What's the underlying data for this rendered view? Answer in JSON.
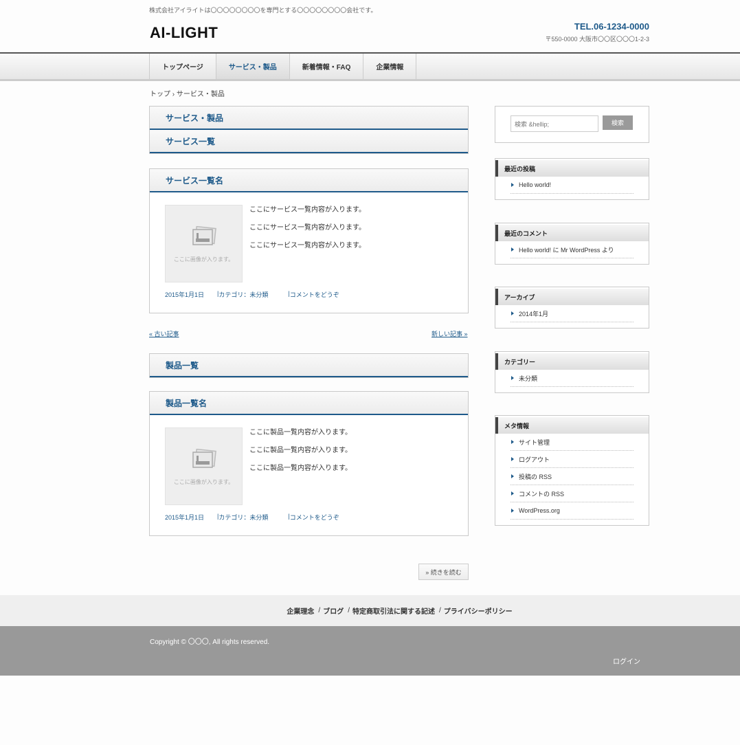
{
  "header": {
    "tagline": "株式会社アイライトは〇〇〇〇〇〇〇〇を専門とする〇〇〇〇〇〇〇〇会社です。",
    "logo": "AI-LIGHT",
    "tel": "TEL.06-1234-0000",
    "address": "〒550-0000 大阪市〇〇区〇〇〇1-2-3"
  },
  "nav": [
    {
      "label": "トップページ"
    },
    {
      "label": "サービス・製品"
    },
    {
      "label": "新着情報・FAQ"
    },
    {
      "label": "企業情報"
    }
  ],
  "breadcrumb": "トップ › サービス・製品",
  "main": {
    "page_title": "サービス・製品",
    "section1_title": "サービス一覧",
    "post1": {
      "title": "サービス一覧名",
      "thumb_text": "ここに画像が入ります。",
      "lines": [
        "ここにサービス一覧内容が入ります。",
        "ここにサービス一覧内容が入ります。",
        "ここにサービス一覧内容が入ります。"
      ],
      "date": "2015年1月1日",
      "category": "カテゴリ：未分類",
      "comment": "コメントをどうぞ"
    },
    "pager_prev": "« 古い記事",
    "pager_next": "新しい記事 »",
    "section2_title": "製品一覧",
    "post2": {
      "title": "製品一覧名",
      "thumb_text": "ここに画像が入ります。",
      "lines": [
        "ここに製品一覧内容が入ります。",
        "ここに製品一覧内容が入ります。",
        "ここに製品一覧内容が入ります。"
      ],
      "date": "2015年1月1日",
      "category": "カテゴリ：未分類",
      "comment": "コメントをどうぞ"
    },
    "more": "» 続きを読む"
  },
  "sidebar": {
    "search_placeholder": "検索 &hellip;",
    "search_button": "検索",
    "recent_posts": {
      "title": "最近の投稿",
      "items": [
        "Hello world!"
      ]
    },
    "recent_comments": {
      "title": "最近のコメント",
      "items": [
        "Hello world! に Mr WordPress より"
      ]
    },
    "archives": {
      "title": "アーカイブ",
      "items": [
        "2014年1月"
      ]
    },
    "categories": {
      "title": "カテゴリー",
      "items": [
        "未分類"
      ]
    },
    "meta": {
      "title": "メタ情報",
      "items": [
        "サイト管理",
        "ログアウト",
        "投稿の RSS",
        "コメントの RSS",
        "WordPress.org"
      ]
    }
  },
  "footer": {
    "links": [
      "企業理念",
      "ブログ",
      "特定商取引法に関する記述",
      "プライバシーポリシー"
    ],
    "separator": "/",
    "copyright": "Copyright © 〇〇〇, All rights reserved.",
    "login": "ログイン"
  },
  "colors": {
    "accent": "#1e5a8a",
    "footer_bg": "#999999"
  }
}
